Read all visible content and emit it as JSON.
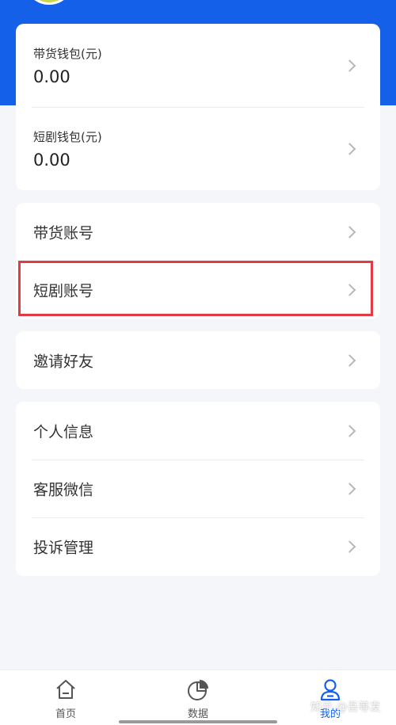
{
  "wallets": [
    {
      "label": "带货钱包(元)",
      "value": "0.00"
    },
    {
      "label": "短剧钱包(元)",
      "value": "0.00"
    }
  ],
  "accounts": [
    {
      "label": "带货账号"
    },
    {
      "label": "短剧账号"
    }
  ],
  "invite": {
    "label": "邀请好友"
  },
  "settings": [
    {
      "label": "个人信息"
    },
    {
      "label": "客服微信"
    },
    {
      "label": "投诉管理"
    }
  ],
  "tabbar": {
    "items": [
      {
        "label": "首页",
        "icon": "home-icon"
      },
      {
        "label": "数据",
        "icon": "pie-chart-icon"
      },
      {
        "label": "我的",
        "icon": "user-icon",
        "active": true
      }
    ]
  },
  "watermark": "知乎 @吾等发",
  "colors": {
    "primary": "#1560e8",
    "highlight": "#e33b43",
    "background": "#f4f6f9"
  }
}
